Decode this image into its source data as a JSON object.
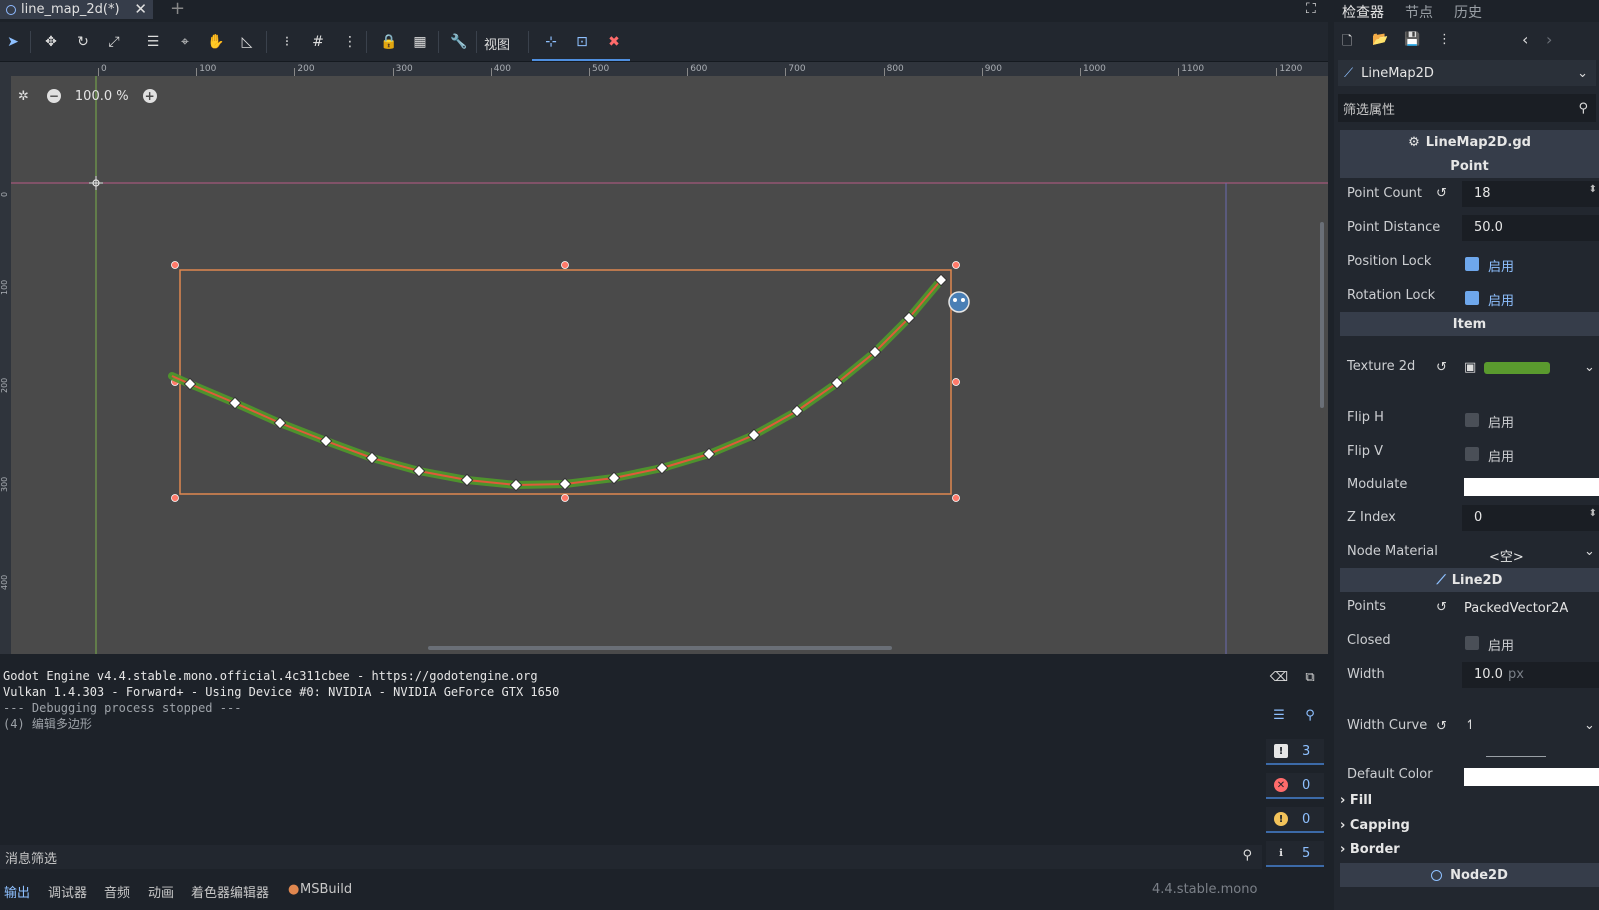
{
  "scene_tab": {
    "title": "line_map_2d(*)"
  },
  "toolbar": {
    "view_menu": "视图"
  },
  "viewport": {
    "zoom": "100.0 %",
    "ruler_h": [
      "0",
      "100",
      "200",
      "300",
      "400",
      "500",
      "600",
      "700",
      "800",
      "900",
      "1000",
      "1100",
      "1200"
    ],
    "ruler_v": [
      "0",
      "100",
      "200",
      "300",
      "400"
    ]
  },
  "output": {
    "lines": [
      "Godot Engine v4.4.stable.mono.official.4c311cbee - https://godotengine.org",
      "Vulkan 1.4.303 - Forward+ - Using Device #0: NVIDIA - NVIDIA GeForce GTX 1650",
      "",
      "--- Debugging process stopped ---",
      "(4) 编辑多边形"
    ],
    "filter_placeholder": "消息筛选",
    "counts": {
      "messages": "3",
      "errors": "0",
      "warnings": "0",
      "editor": "5"
    }
  },
  "bottom_tabs": [
    "输出",
    "调试器",
    "音频",
    "动画",
    "着色器编辑器",
    "MSBuild"
  ],
  "version": "4.4.stable.mono",
  "dock": {
    "tabs": [
      "检查器",
      "节点",
      "历史"
    ],
    "node_name": "LineMap2D",
    "filter_placeholder": "筛选属性",
    "script_name": "LineMap2D.gd",
    "sections": {
      "point": "Point",
      "item": "Item",
      "line2d": "Line2D",
      "node2d": "Node2D"
    },
    "props": {
      "point_count": {
        "label": "Point Count",
        "value": "18"
      },
      "point_distance": {
        "label": "Point Distance",
        "value": "50.0"
      },
      "position_lock": {
        "label": "Position Lock",
        "check": "启用"
      },
      "rotation_lock": {
        "label": "Rotation Lock",
        "check": "启用"
      },
      "texture_2d": {
        "label": "Texture 2d"
      },
      "flip_h": {
        "label": "Flip H",
        "check": "启用"
      },
      "flip_v": {
        "label": "Flip V",
        "check": "启用"
      },
      "modulate": {
        "label": "Modulate"
      },
      "z_index": {
        "label": "Z Index",
        "value": "0"
      },
      "node_material": {
        "label": "Node Material",
        "value": "<空>"
      },
      "points": {
        "label": "Points",
        "value": "PackedVector2A"
      },
      "closed": {
        "label": "Closed",
        "check": "启用"
      },
      "width": {
        "label": "Width",
        "value": "10.0",
        "unit": "px"
      },
      "width_curve": {
        "label": "Width Curve"
      },
      "default_color": {
        "label": "Default Color"
      }
    },
    "groups": [
      "Fill",
      "Capping",
      "Border"
    ]
  },
  "colors": {
    "accent": "#8ec0ff",
    "selection_rect": "#e0874f",
    "curve_line": "#e05a3a",
    "grass": "#4f9a2a"
  }
}
